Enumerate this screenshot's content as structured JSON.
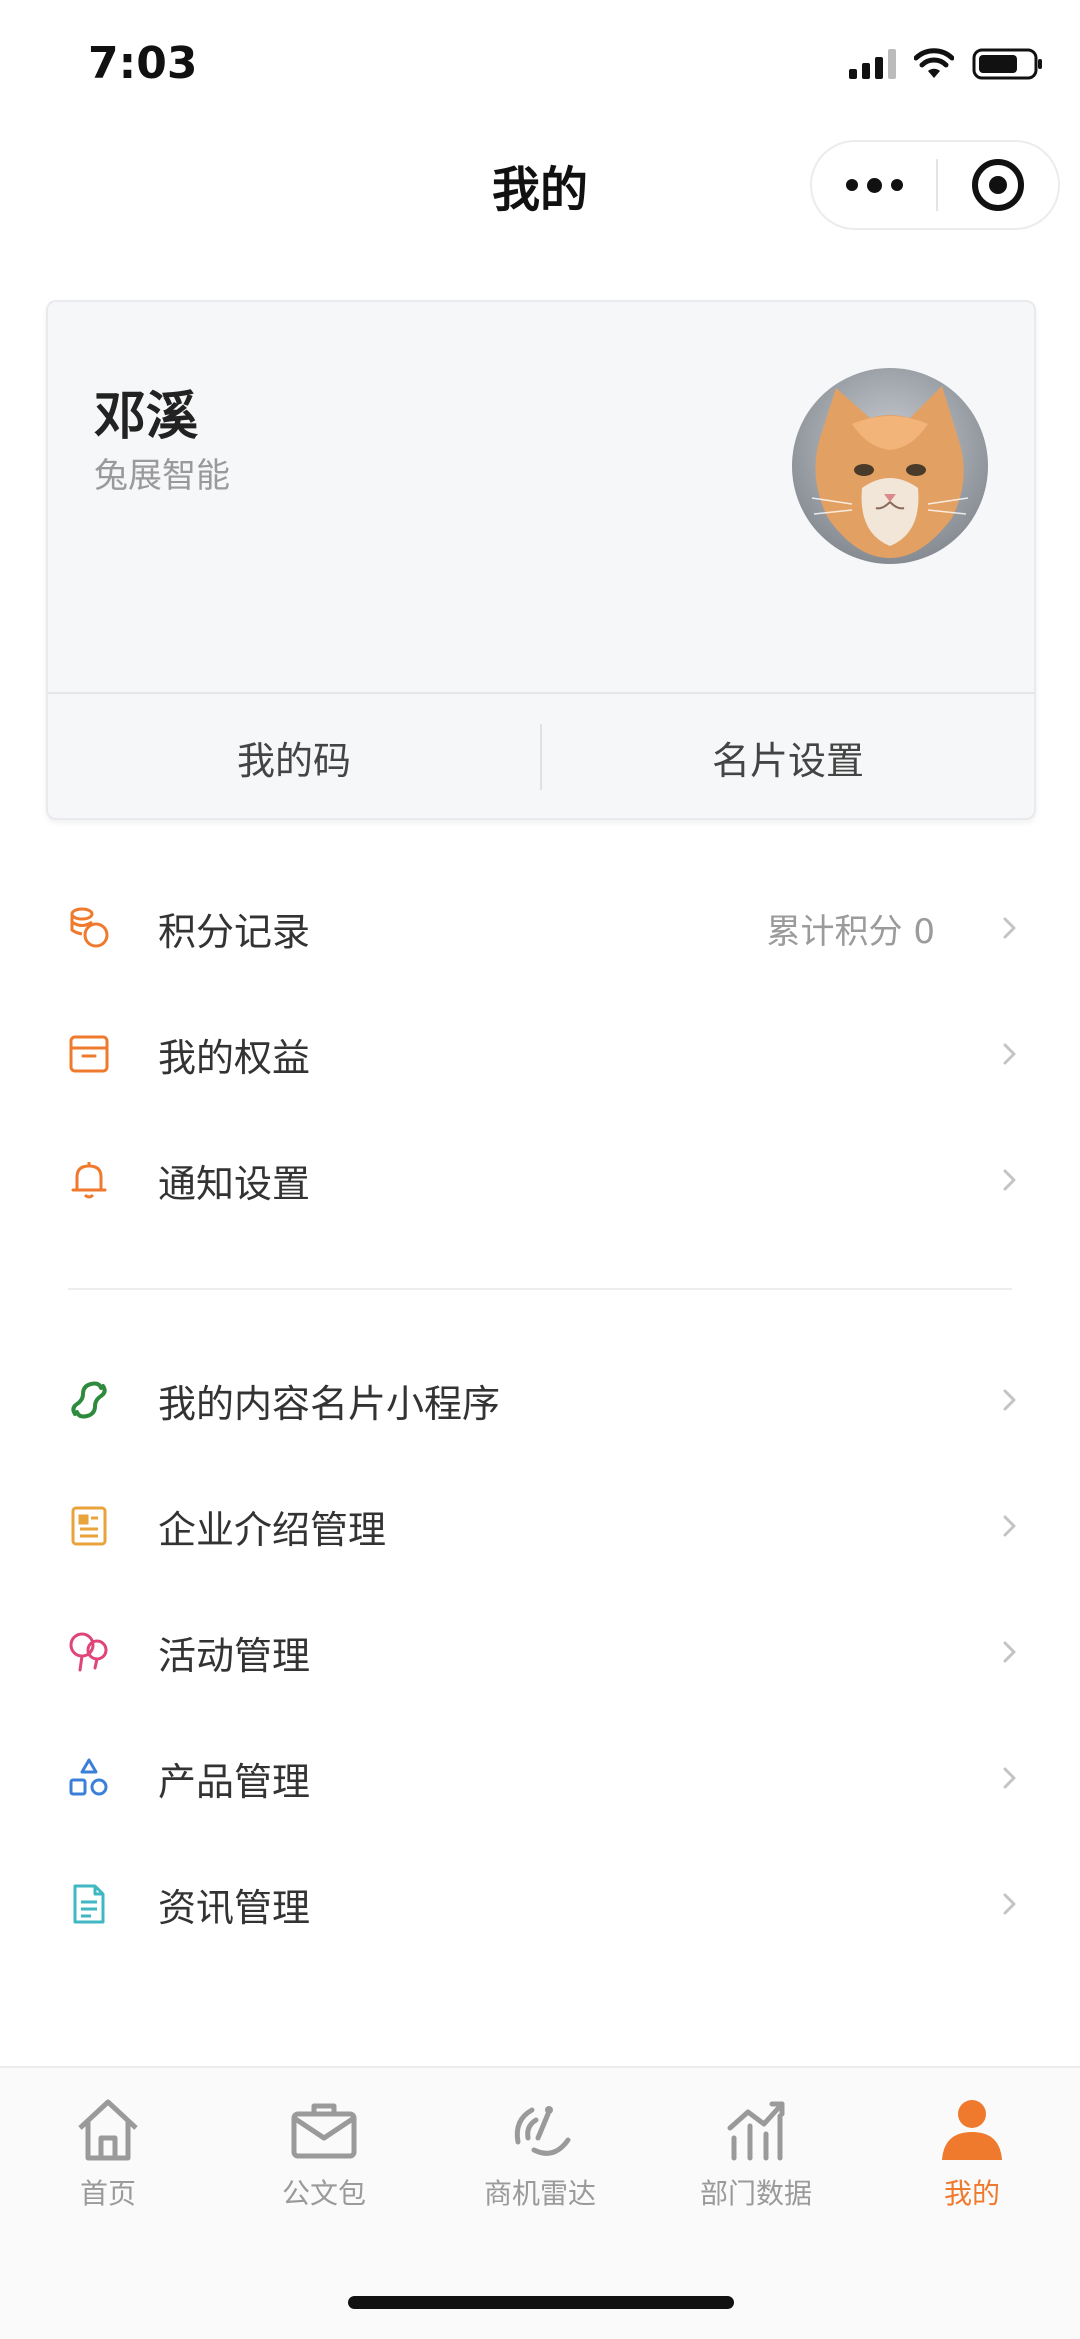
{
  "status_bar": {
    "time": "7:03"
  },
  "nav": {
    "title": "我的"
  },
  "profile": {
    "name": "邓溪",
    "company": "兔展智能",
    "buttons": {
      "my_code": "我的码",
      "card_settings": "名片设置"
    }
  },
  "menu_group1": [
    {
      "label": "积分记录",
      "extra": "累计积分 0",
      "icon": "coins-icon",
      "color": "#ef7a2e"
    },
    {
      "label": "我的权益",
      "icon": "box-icon",
      "color": "#ef7a2e"
    },
    {
      "label": "通知设置",
      "icon": "bell-icon",
      "color": "#ef7a2e"
    }
  ],
  "menu_group2": [
    {
      "label": "我的内容名片小程序",
      "icon": "mini-program-icon",
      "color": "#2e8b3e"
    },
    {
      "label": "企业介绍管理",
      "icon": "document-card-icon",
      "color": "#e8a33a"
    },
    {
      "label": "活动管理",
      "icon": "balloon-icon",
      "color": "#e0457a"
    },
    {
      "label": "产品管理",
      "icon": "shapes-icon",
      "color": "#3b7fd8"
    },
    {
      "label": "资讯管理",
      "icon": "article-icon",
      "color": "#3fb8c4"
    }
  ],
  "tabbar": [
    {
      "label": "首页",
      "icon": "home-icon"
    },
    {
      "label": "公文包",
      "icon": "briefcase-icon"
    },
    {
      "label": "商机雷达",
      "icon": "radar-icon"
    },
    {
      "label": "部门数据",
      "icon": "chart-icon"
    },
    {
      "label": "我的",
      "icon": "user-icon",
      "active": true
    }
  ],
  "colors": {
    "accent": "#ef7a2e",
    "tab_inactive": "#9a9a9a"
  }
}
